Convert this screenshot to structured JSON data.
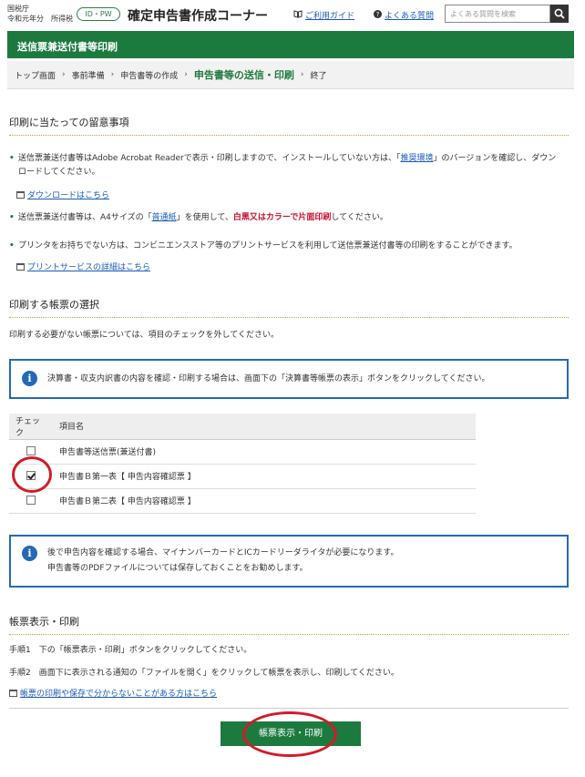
{
  "header": {
    "agency_line1": "国税庁",
    "agency_line2": "令和元年分　所得税",
    "id_pw_badge": "ID・PW",
    "corner_title": "確定申告書作成コーナー",
    "guide_link": "ご利用ガイド",
    "faq_link": "よくある質問",
    "search_placeholder": "よくある質問を検索"
  },
  "page_title": "送信票兼送付書等印刷",
  "breadcrumb": {
    "items": [
      "トップ画面",
      "事前準備",
      "申告書等の作成"
    ],
    "current": "申告書等の送信・印刷",
    "last": "終了"
  },
  "notes": {
    "title": "印刷に当たっての留意事項",
    "bullet1_a": "送信票兼送付書等はAdobe Acrobat Readerで表示・印刷しますので、インストールしていない方は、「",
    "bullet1_link": "推奨環境",
    "bullet1_b": "」のバージョンを確認し、ダウンロードしてください。",
    "download_link": "ダウンロードはこちら",
    "bullet2_a": "送信票兼送付書等は、A4サイズの「",
    "bullet2_link": "普通紙",
    "bullet2_b": "」を使用して、",
    "bullet2_red": "白黒又はカラーで片面印刷",
    "bullet2_c": "してください。",
    "bullet3": "プリンタをお持ちでない方は、コンビニエンスストア等のプリントサービスを利用して送信票兼送付書等の印刷をすることができます。",
    "print_service_link": "プリントサービスの詳細はこちら"
  },
  "selection": {
    "title": "印刷する帳票の選択",
    "description": "印刷する必要がない帳票については、項目のチェックを外してください。",
    "info1": "決算書・収支内訳書の内容を確認・印刷する場合は、画面下の「決算書等帳票の表示」ボタンをクリックしてください。",
    "table": {
      "headers": [
        "チェック",
        "項目名"
      ],
      "rows": [
        {
          "checked": false,
          "name": "申告書等送信票(兼送付書)"
        },
        {
          "checked": true,
          "name": "申告書Ｂ第一表【 申告内容確認票 】"
        },
        {
          "checked": false,
          "name": "申告書Ｂ第二表【 申告内容確認票 】"
        }
      ]
    },
    "info2_line1": "後で申告内容を確認する場合、マイナンバーカードとICカードリーダライタが必要になります。",
    "info2_line2": "申告書等のPDFファイルについては保存しておくことをお勧めします。"
  },
  "print": {
    "title": "帳票表示・印刷",
    "step1": "手順1　下の「帳票表示・印刷」ボタンをクリックしてください。",
    "step2": "手順2　画面下に表示される通知の「ファイルを開く」をクリックして帳票を表示し、印刷してください。",
    "help_link": "帳票の印刷や保存で分からないことがある方はこちら",
    "button": "帳票表示・印刷"
  },
  "colors": {
    "brand_green": "#1c7a3f",
    "info_blue": "#2469b8",
    "annotation_red": "#d21b2a"
  },
  "icons": [
    "book-icon",
    "help-circle-icon",
    "search-icon",
    "window-icon",
    "info-icon",
    "chevron-right-icon"
  ]
}
